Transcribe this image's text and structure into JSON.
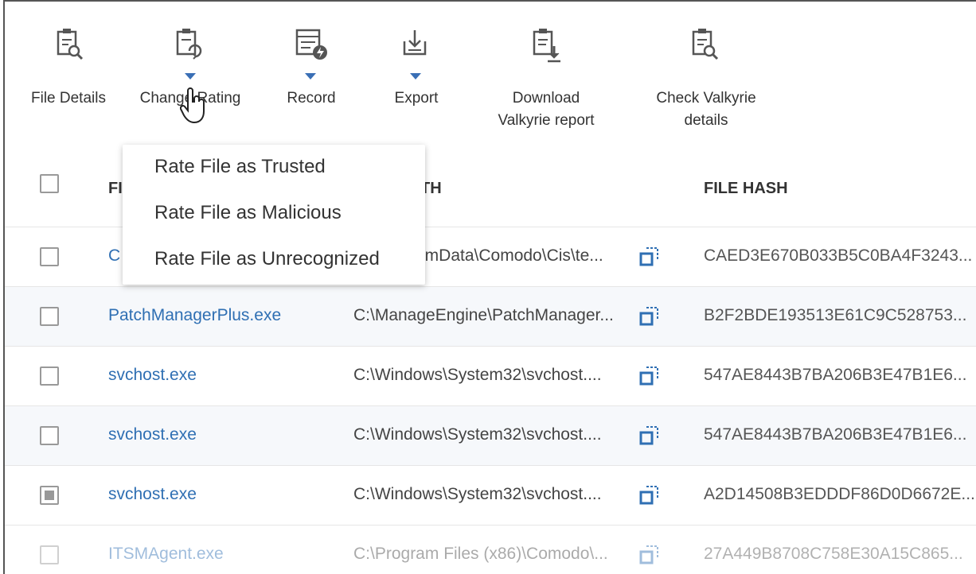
{
  "toolbar": {
    "file_details": "File Details",
    "change_rating": "Change Rating",
    "record": "Record",
    "export": "Export",
    "download_line1": "Download",
    "download_line2": "Valkyrie report",
    "check_line1": "Check Valkyrie",
    "check_line2": "details"
  },
  "dropdown": {
    "items": [
      "Rate File as Trusted",
      "Rate File as Malicious",
      "Rate File as Unrecognized"
    ]
  },
  "table": {
    "header_name_visible": "FI",
    "header_path_visible": "TH",
    "header_hash": "FILE HASH",
    "rows": [
      {
        "name": "C",
        "path": "amData\\Comodo\\Cis\\te...",
        "hash": "CAED3E670B033B5C0BA4F3243...",
        "checked": false
      },
      {
        "name": "PatchManagerPlus.exe",
        "path": "C:\\ManageEngine\\PatchManager...",
        "hash": "B2F2BDE193513E61C9C528753...",
        "checked": false
      },
      {
        "name": "svchost.exe",
        "path": "C:\\Windows\\System32\\svchost....",
        "hash": "547AE8443B7BA206B3E47B1E6...",
        "checked": false
      },
      {
        "name": "svchost.exe",
        "path": "C:\\Windows\\System32\\svchost....",
        "hash": "547AE8443B7BA206B3E47B1E6...",
        "checked": false
      },
      {
        "name": "svchost.exe",
        "path": "C:\\Windows\\System32\\svchost....",
        "hash": "A2D14508B3EDDDF86D0D6672E...",
        "checked": true
      },
      {
        "name": "ITSMAgent.exe",
        "path": "C:\\Program Files (x86)\\Comodo\\...",
        "hash": "27A449B8708C758E30A15C865...",
        "checked": false
      }
    ]
  },
  "colors": {
    "accent": "#3a6fb5",
    "link": "#2f6fb3"
  }
}
